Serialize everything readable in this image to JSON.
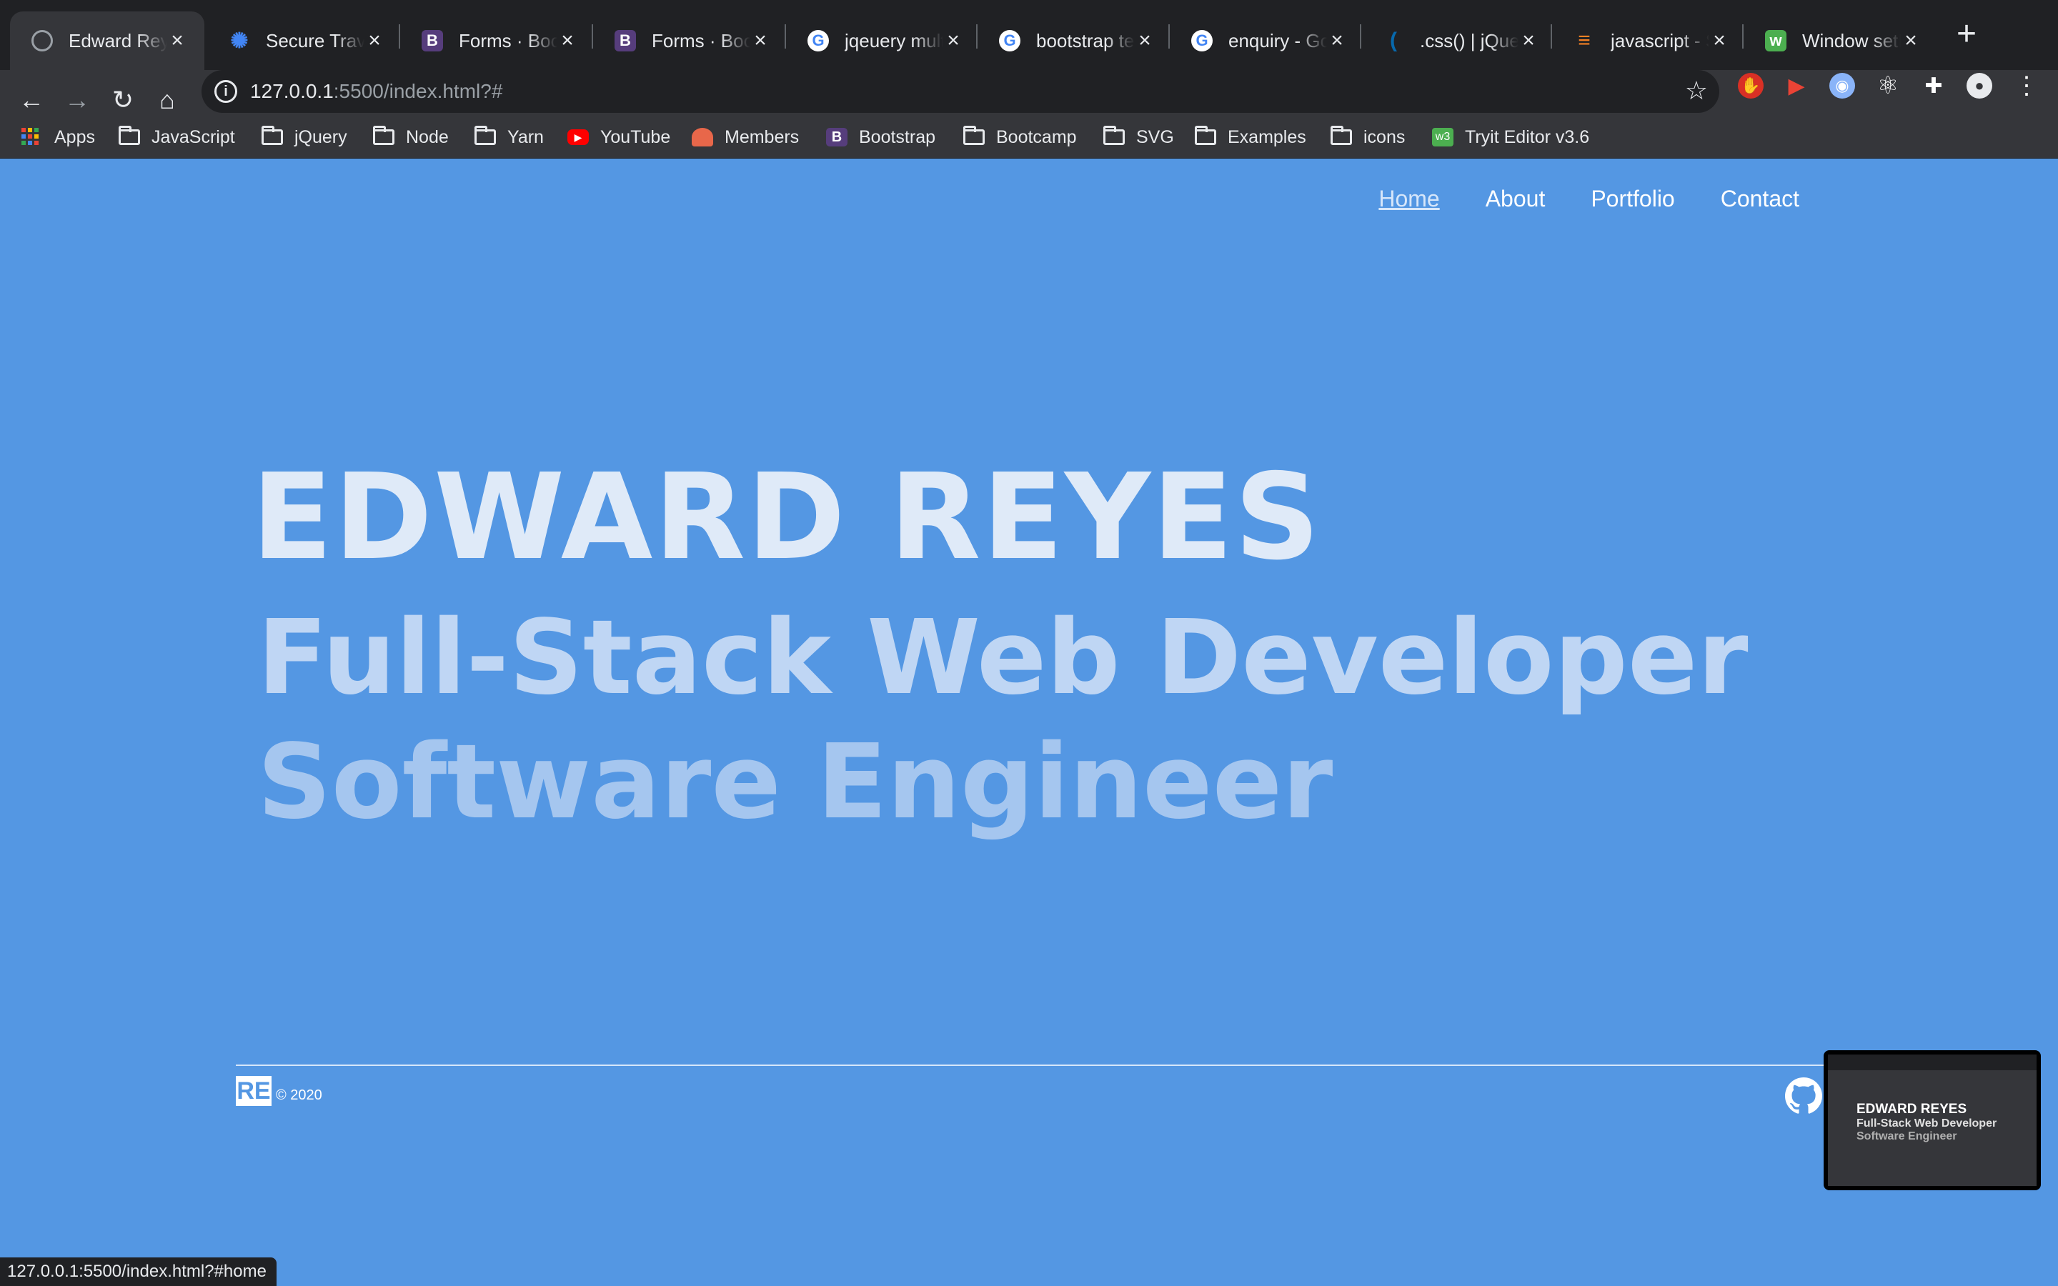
{
  "tabs": [
    {
      "title": "Edward Reyes",
      "icon": "globe-icon",
      "color": "#5f6368",
      "glyph": "",
      "active": true
    },
    {
      "title": "Secure Travel",
      "icon": "gear-icon",
      "color": "#4285f4",
      "glyph": "✺"
    },
    {
      "title": "Forms · Bootstrap",
      "icon": "bootstrap-icon",
      "color": "#563d7c",
      "glyph": "B"
    },
    {
      "title": "Forms · Bootstrap",
      "icon": "bootstrap-icon",
      "color": "#563d7c",
      "glyph": "B"
    },
    {
      "title": "jqeuery multiple",
      "icon": "google-icon",
      "color": "#ffffff",
      "glyph": "G"
    },
    {
      "title": "bootstrap text",
      "icon": "google-icon",
      "color": "#ffffff",
      "glyph": "G"
    },
    {
      "title": "enquiry - Google",
      "icon": "google-icon",
      "color": "#ffffff",
      "glyph": "G"
    },
    {
      "title": ".css() | jQuery",
      "icon": "jquery-icon",
      "color": "#0769ad",
      "glyph": "("
    },
    {
      "title": "javascript - Stack",
      "icon": "stackoverflow-icon",
      "color": "#f48024",
      "glyph": "≡"
    },
    {
      "title": "Window setInterval",
      "icon": "w3schools-icon",
      "color": "#4caf50",
      "glyph": "w"
    }
  ],
  "url": {
    "host": "127.0.0.1",
    "path": ":5500/index.html?#"
  },
  "bookmarks": [
    {
      "label": "Apps",
      "type": "apps"
    },
    {
      "label": "JavaScript",
      "type": "folder"
    },
    {
      "label": "jQuery",
      "type": "folder"
    },
    {
      "label": "Node",
      "type": "folder"
    },
    {
      "label": "Yarn",
      "type": "folder"
    },
    {
      "label": "YouTube",
      "type": "youtube"
    },
    {
      "label": "Members",
      "type": "members"
    },
    {
      "label": "Bootstrap",
      "type": "bootstrap"
    },
    {
      "label": "Bootcamp",
      "type": "folder"
    },
    {
      "label": "SVG",
      "type": "folder"
    },
    {
      "label": "Examples",
      "type": "folder"
    },
    {
      "label": "icons",
      "type": "folder"
    },
    {
      "label": "Tryit Editor v3.6",
      "type": "tryit"
    }
  ],
  "nav": {
    "home": "Home",
    "about": "About",
    "portfolio": "Portfolio",
    "contact": "Contact"
  },
  "hero": {
    "name": "EDWARD REYES",
    "title1": "Full-Stack Web Developer",
    "title2": "Software Engineer"
  },
  "footer": {
    "logo": "RE",
    "copyright": "© 2020"
  },
  "thumbnail": {
    "name": "EDWARD REYES",
    "title1": "Full-Stack Web Developer",
    "title2": "Software Engineer"
  },
  "status_url": "127.0.0.1:5500/index.html?#home",
  "colors": {
    "page_bg": "#5497e3",
    "chrome_dark": "#202124",
    "chrome_mid": "#35363a"
  }
}
